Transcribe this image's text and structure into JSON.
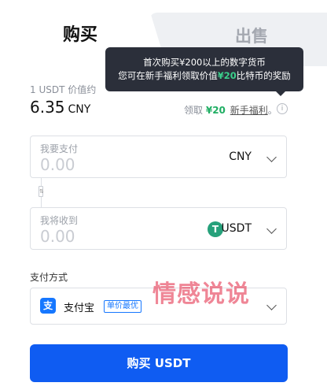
{
  "tabs": {
    "buy": "购买",
    "sell": "出售"
  },
  "tooltip": {
    "line1": "首次购买¥200以上的数字货币",
    "line2_prefix": "您可在新手福利领取价值",
    "line2_amount": "¥20",
    "line2_suffix": "比特币的奖励"
  },
  "price": {
    "label": "1 USDT 价值约",
    "value": "6.35",
    "unit": "CNY"
  },
  "bonus": {
    "prefix": "领取",
    "amount": "¥20",
    "link": "新手福利",
    "suffix": "。",
    "info": "i"
  },
  "pay_input": {
    "label": "我要支付",
    "placeholder": "0.00",
    "currency": "CNY"
  },
  "swap_icon": "⇅",
  "receive_input": {
    "label": "我将收到",
    "placeholder": "0.00",
    "currency": "USDT",
    "token_glyph": "T"
  },
  "payment": {
    "label": "支付方式",
    "method_glyph": "支",
    "method": "支付宝",
    "badge": "单价最优"
  },
  "watermark": "情感说说",
  "buy_button": "购买 USDT",
  "colors": {
    "accent": "#0f5cf2",
    "green": "#1fae63",
    "tether": "#26a17b",
    "tooltip_bg": "#2b2f3a"
  }
}
